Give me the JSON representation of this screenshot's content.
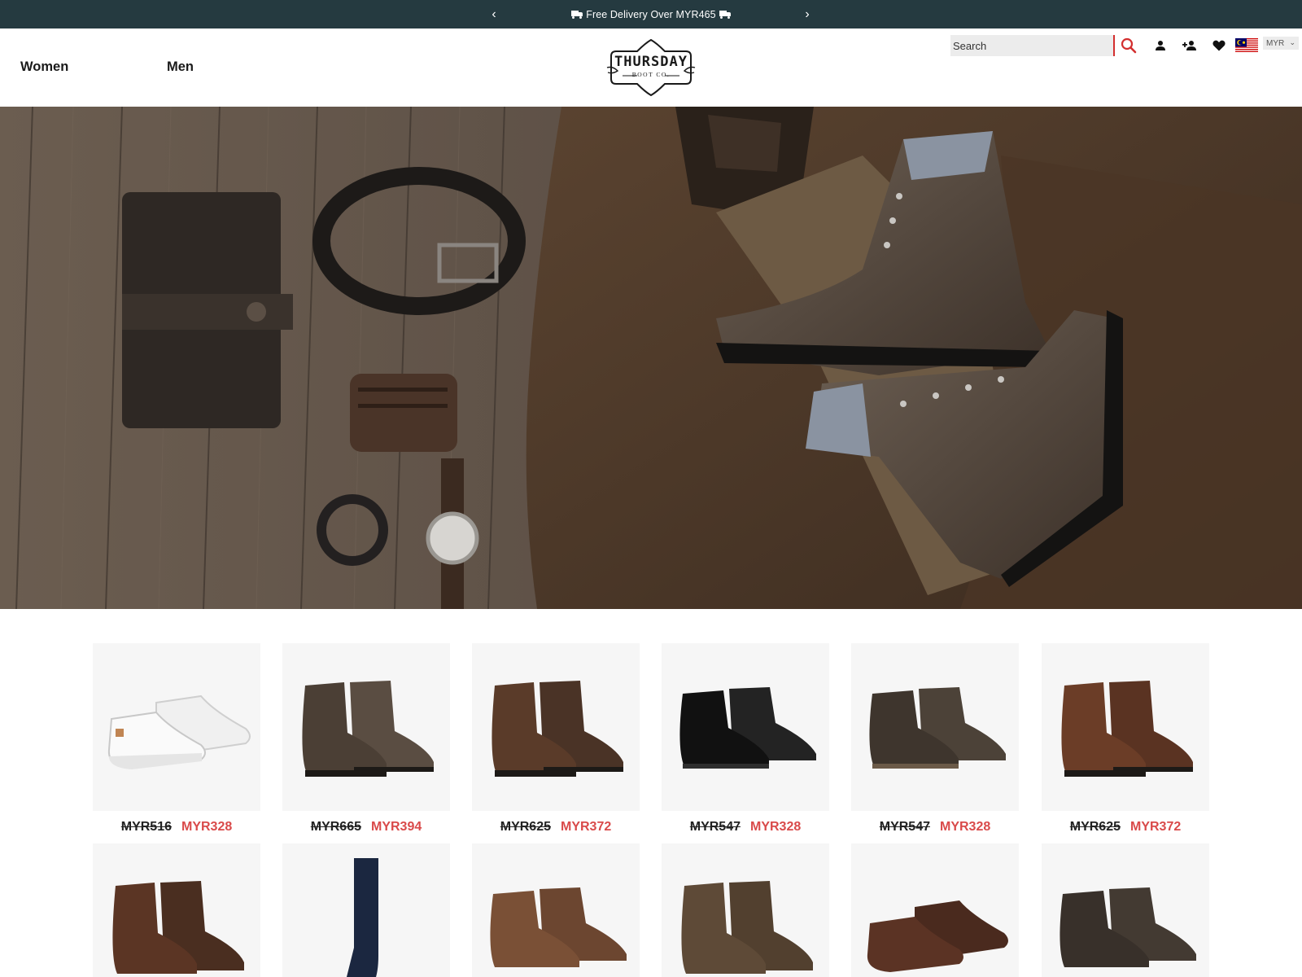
{
  "announcement": {
    "message": "Free Delivery Over MYR465",
    "prev_icon": "chevron-left-icon",
    "next_icon": "chevron-right-icon",
    "background": "#253a40"
  },
  "header": {
    "nav": [
      {
        "label": "Women"
      },
      {
        "label": "Men"
      }
    ],
    "logo": {
      "line1": "THURSDAY",
      "line2": "BOOT CO."
    },
    "search": {
      "placeholder": "Search"
    },
    "currency": {
      "selected": "MYR"
    },
    "accent": "#d32f2f"
  },
  "hero": {
    "icon": "lifestyle-flatlay-image"
  },
  "products": [
    {
      "was": "MYR516",
      "now": "MYR328",
      "item": "white-sneaker"
    },
    {
      "was": "MYR665",
      "now": "MYR394",
      "item": "gray-captoe-boot"
    },
    {
      "was": "MYR625",
      "now": "MYR372",
      "item": "brown-captoe-boot"
    },
    {
      "was": "MYR547",
      "now": "MYR328",
      "item": "black-chukka"
    },
    {
      "was": "MYR547",
      "now": "MYR328",
      "item": "gray-suede-chukka"
    },
    {
      "was": "MYR625",
      "now": "MYR372",
      "item": "brown-plain-boot"
    },
    {
      "was": "",
      "now": "",
      "item": "brown-lace-boot"
    },
    {
      "was": "",
      "now": "",
      "item": "navy-sock"
    },
    {
      "was": "",
      "now": "",
      "item": "tan-suede-chukka"
    },
    {
      "was": "",
      "now": "",
      "item": "moc-toe-boot"
    },
    {
      "was": "",
      "now": "",
      "item": "brown-sneaker"
    },
    {
      "was": "",
      "now": "",
      "item": "gray-suede-chukka-wedge"
    }
  ],
  "colors": {
    "sale_price": "#d94a4a",
    "card_bg": "#f6f6f6"
  }
}
